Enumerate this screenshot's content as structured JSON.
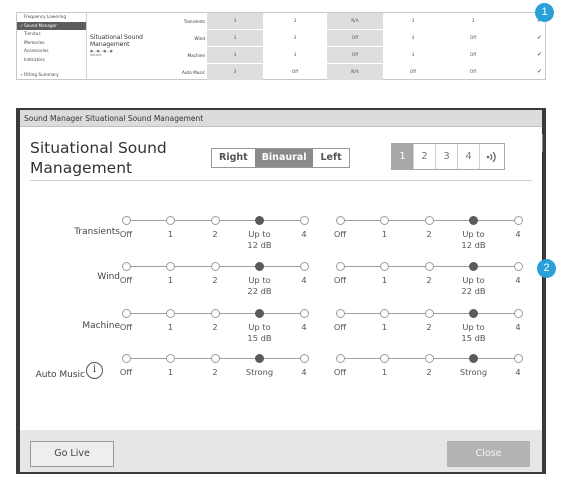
{
  "summary": {
    "nav": [
      {
        "label": "Frequency Lowering",
        "check": ""
      },
      {
        "label": "Sound Manager",
        "check": "✓",
        "active": true
      },
      {
        "label": "Tinnitus",
        "check": ""
      },
      {
        "label": "Memories",
        "check": ""
      },
      {
        "label": "Accessories",
        "check": ""
      },
      {
        "label": "Indicators",
        "check": ""
      }
    ],
    "nav_bottom": {
      "label": "Fitting Summary",
      "check": "✓"
    },
    "title": "Situational Sound Management",
    "title_dots": "●—●—●—●",
    "title_sub": "details",
    "rows": [
      {
        "label": "Transients",
        "cells": [
          "3",
          "3",
          "N/A",
          "3",
          "3"
        ],
        "check": "✓"
      },
      {
        "label": "Wind",
        "cells": [
          "3",
          "3",
          "Off",
          "4",
          "Off"
        ],
        "check": "✓"
      },
      {
        "label": "Machine",
        "cells": [
          "3",
          "3",
          "Off",
          "3",
          "Off"
        ],
        "check": "✓"
      },
      {
        "label": "Auto Music",
        "cells": [
          "3",
          "Off",
          "N/A",
          "Off",
          "Off"
        ],
        "check": "✓"
      }
    ]
  },
  "badges": {
    "one": "1",
    "two": "2"
  },
  "dialog": {
    "window_title": "Sound Manager Situational Sound Management",
    "heading": "Situational Sound Management",
    "side_toggle": {
      "right": "Right",
      "binaural": "Binaural",
      "left": "Left",
      "selected": "Binaural"
    },
    "program_tabs": {
      "tabs": [
        "1",
        "2",
        "3",
        "4"
      ],
      "stream_icon": "streaming-icon",
      "selected": "1"
    },
    "rows": [
      {
        "label": "Transients",
        "positions": [
          "Off",
          "1",
          "2",
          "Up to 12 dB",
          "4"
        ],
        "tick_lines": [
          [
            "Off"
          ],
          [
            "1"
          ],
          [
            "2"
          ],
          [
            "Up to",
            "12 dB"
          ],
          [
            "4"
          ]
        ],
        "right_value": "Up to 12 dB",
        "left_value": "Up to 12 dB"
      },
      {
        "label": "Wind",
        "positions": [
          "Off",
          "1",
          "2",
          "Up to 22 dB",
          "4"
        ],
        "tick_lines": [
          [
            "Off"
          ],
          [
            "1"
          ],
          [
            "2"
          ],
          [
            "Up to",
            "22 dB"
          ],
          [
            "4"
          ]
        ],
        "right_value": "Up to 22 dB",
        "left_value": "Up to 22 dB"
      },
      {
        "label": "Machine",
        "positions": [
          "Off",
          "1",
          "2",
          "Up to 15 dB",
          "4"
        ],
        "tick_lines": [
          [
            "Off"
          ],
          [
            "1"
          ],
          [
            "2"
          ],
          [
            "Up to",
            "15 dB"
          ],
          [
            "4"
          ]
        ],
        "right_value": "Up to 15 dB",
        "left_value": "Up to 15 dB"
      },
      {
        "label": "Auto Music",
        "positions": [
          "Off",
          "1",
          "2",
          "Strong",
          "4"
        ],
        "tick_lines": [
          [
            "Off"
          ],
          [
            "1"
          ],
          [
            "2"
          ],
          [
            "Strong"
          ],
          [
            "4"
          ]
        ],
        "right_value": "Strong",
        "left_value": "Strong"
      }
    ],
    "info_icon": "i",
    "go_live_label": "Go Live",
    "close_label": "Close"
  }
}
